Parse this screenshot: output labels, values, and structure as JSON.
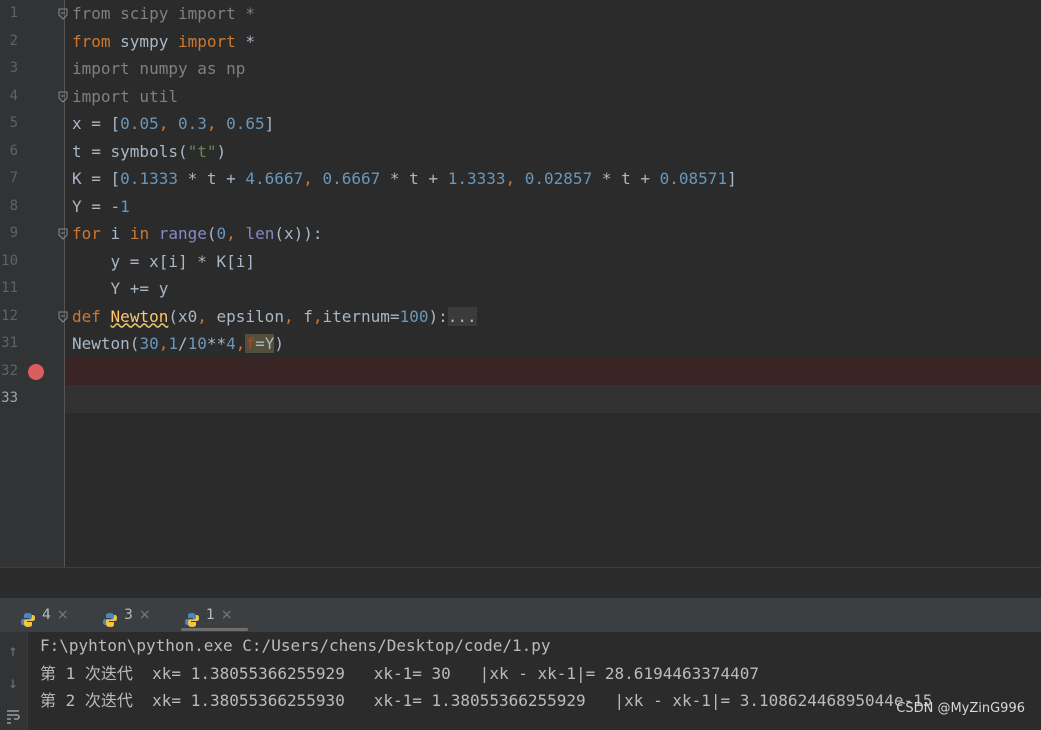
{
  "editor": {
    "line_numbers": [
      "1",
      "2",
      "3",
      "4",
      "5",
      "6",
      "7",
      "8",
      "9",
      "10",
      "11",
      "12",
      "31",
      "32",
      "33"
    ],
    "lines": [
      {
        "segments": [
          {
            "t": "from scipy import *",
            "c": "dim"
          }
        ]
      },
      {
        "segments": [
          {
            "t": "from",
            "c": "kw"
          },
          {
            "t": " sympy ",
            "c": ""
          },
          {
            "t": "import",
            "c": "kw"
          },
          {
            "t": " *",
            "c": ""
          }
        ]
      },
      {
        "segments": [
          {
            "t": "import numpy as np",
            "c": "dim"
          }
        ]
      },
      {
        "segments": [
          {
            "t": "import util",
            "c": "dim"
          }
        ]
      },
      {
        "segments": [
          {
            "t": "x = [",
            "c": ""
          },
          {
            "t": "0.05",
            "c": "num"
          },
          {
            "t": ", ",
            "c": "kw"
          },
          {
            "t": "0.3",
            "c": "num"
          },
          {
            "t": ", ",
            "c": "kw"
          },
          {
            "t": "0.65",
            "c": "num"
          },
          {
            "t": "]",
            "c": ""
          }
        ]
      },
      {
        "segments": [
          {
            "t": "t = symbols(",
            "c": ""
          },
          {
            "t": "\"t\"",
            "c": "str"
          },
          {
            "t": ")",
            "c": ""
          }
        ]
      },
      {
        "segments": [
          {
            "t": "K = [",
            "c": ""
          },
          {
            "t": "0.1333",
            "c": "num"
          },
          {
            "t": " * t + ",
            "c": ""
          },
          {
            "t": "4.6667",
            "c": "num"
          },
          {
            "t": ", ",
            "c": "kw"
          },
          {
            "t": "0.6667",
            "c": "num"
          },
          {
            "t": " * t + ",
            "c": ""
          },
          {
            "t": "1.3333",
            "c": "num"
          },
          {
            "t": ", ",
            "c": "kw"
          },
          {
            "t": "0.02857",
            "c": "num"
          },
          {
            "t": " * t + ",
            "c": ""
          },
          {
            "t": "0.08571",
            "c": "num"
          },
          {
            "t": "]",
            "c": ""
          }
        ]
      },
      {
        "segments": [
          {
            "t": "Y = -",
            "c": ""
          },
          {
            "t": "1",
            "c": "num"
          }
        ]
      },
      {
        "segments": [
          {
            "t": "for",
            "c": "kw"
          },
          {
            "t": " i ",
            "c": ""
          },
          {
            "t": "in",
            "c": "kw"
          },
          {
            "t": " ",
            "c": ""
          },
          {
            "t": "range",
            "c": "bi"
          },
          {
            "t": "(",
            "c": ""
          },
          {
            "t": "0",
            "c": "num"
          },
          {
            "t": ", ",
            "c": "kw"
          },
          {
            "t": "len",
            "c": "bi"
          },
          {
            "t": "(x)):",
            "c": ""
          }
        ]
      },
      {
        "segments": [
          {
            "t": "    y = x[i] * K[i]",
            "c": ""
          }
        ]
      },
      {
        "segments": [
          {
            "t": "    Y += y",
            "c": ""
          }
        ]
      },
      {
        "segments": [
          {
            "t": "def",
            "c": "kw"
          },
          {
            "t": " ",
            "c": ""
          },
          {
            "t": "Newton",
            "c": "fn"
          },
          {
            "t": "(x0",
            "c": ""
          },
          {
            "t": ", ",
            "c": "kw"
          },
          {
            "t": "epsilon",
            "c": ""
          },
          {
            "t": ", ",
            "c": "kw"
          },
          {
            "t": "f",
            "c": ""
          },
          {
            "t": ",",
            "c": "kw"
          },
          {
            "t": "iternum=",
            "c": ""
          },
          {
            "t": "100",
            "c": "num"
          },
          {
            "t": "):",
            "c": ""
          },
          {
            "t": "...",
            "c": "fold-box"
          }
        ]
      },
      {
        "segments": [
          {
            "t": "Newton(",
            "c": ""
          },
          {
            "t": "30",
            "c": "num"
          },
          {
            "t": ",",
            "c": "kw"
          },
          {
            "t": "1",
            "c": "num"
          },
          {
            "t": "/",
            "c": ""
          },
          {
            "t": "10",
            "c": "num"
          },
          {
            "t": "**",
            "c": ""
          },
          {
            "t": "4",
            "c": "num"
          },
          {
            "t": ",",
            "c": "kw"
          },
          {
            "t": "f",
            "c": "param hl"
          },
          {
            "t": "=Y",
            "c": "hl"
          },
          {
            "t": ")",
            "c": ""
          }
        ]
      },
      {
        "segments": []
      },
      {
        "segments": []
      }
    ]
  },
  "run_tabs": [
    {
      "label": "4",
      "close": "×"
    },
    {
      "label": "3",
      "close": "×"
    },
    {
      "label": "1",
      "close": "×"
    }
  ],
  "console": {
    "lines": [
      "F:\\pyhton\\python.exe C:/Users/chens/Desktop/code/1.py",
      "第 1 次迭代  xk= 1.38055366255929   xk-1= 30   |xk - xk-1|= 28.6194463374407",
      "第 2 次迭代  xk= 1.38055366255930   xk-1= 1.38055366255929   |xk - xk-1|= 3.10862446895044e-15"
    ]
  },
  "watermark": "CSDN @MyZinG996",
  "icons": {
    "up": "arrow-up-icon",
    "down": "arrow-down-icon",
    "wrap": "soft-wrap-icon",
    "python": "python-icon",
    "breakpoint": "breakpoint-icon"
  }
}
